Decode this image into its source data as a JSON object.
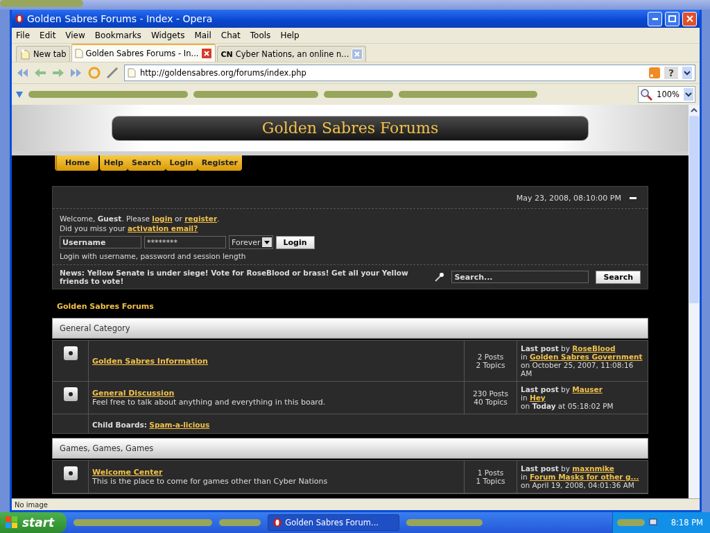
{
  "window": {
    "title": "Golden Sabres Forums - Index - Opera"
  },
  "menu": [
    "File",
    "Edit",
    "View",
    "Bookmarks",
    "Widgets",
    "Mail",
    "Chat",
    "Tools",
    "Help"
  ],
  "tabs": [
    {
      "kind": "new",
      "label": "New tab",
      "selected": false
    },
    {
      "kind": "page",
      "label": "Golden Sabres Forums - In...",
      "selected": true
    },
    {
      "kind": "logo",
      "badge": "CN",
      "label": "Cyber Nations, an online n...",
      "selected": false
    }
  ],
  "address": {
    "url": "http://goldensabres.org/forums/index.php",
    "help": "?"
  },
  "zoom": {
    "value": "100%"
  },
  "page": {
    "site_title": "Golden Sabres Forums",
    "nav": [
      {
        "label": "Home",
        "selected": true
      },
      {
        "label": "Help",
        "selected": false
      },
      {
        "label": "Search",
        "selected": false
      },
      {
        "label": "Login",
        "selected": false
      },
      {
        "label": "Register",
        "selected": false
      }
    ],
    "date": "May 23, 2008, 08:10:00 PM",
    "welcome": [
      {
        "kind": "text",
        "text": "Welcome, **Guest**. Please "
      },
      {
        "kind": "link",
        "text": "login"
      },
      {
        "kind": "text",
        "text": " or "
      },
      {
        "kind": "link",
        "text": "register"
      },
      {
        "kind": "text",
        "text": "."
      }
    ],
    "activation": [
      {
        "kind": "text",
        "text": "Did you miss your "
      },
      {
        "kind": "link",
        "text": "activation email?"
      }
    ],
    "login": {
      "username": "Username",
      "password": "********",
      "length": "Forever",
      "button": "Login",
      "hint": "Login with username, password and session length"
    },
    "news": "**News:**  Yellow Senate is under siege!  Vote for RoseBlood or brass! Get all your Yellow friends to vote!",
    "search": {
      "value": "Search...",
      "button": "Search"
    },
    "board_index": "Golden Sabres Forums",
    "categories": [
      {
        "name": "General Category",
        "boards": [
          {
            "title": "Golden Sabres Information",
            "posts": "2 Posts",
            "topics": "2 Topics",
            "last_label": "Last post",
            "by_label": "by",
            "in_label": "in",
            "by": "RoseBlood",
            "in": "Golden Sabres Government",
            "on": "on October 25, 2007, 11:08:16 AM"
          },
          {
            "title": "General Discussion",
            "description": "Feel free to talk about anything and everything in this board.",
            "posts": "230 Posts",
            "topics": "40 Topics",
            "last_label": "Last post",
            "by_label": "by",
            "in_label": "in",
            "by": "Mauser",
            "in": "Hey",
            "on": "on **Today** at 05:18:02 PM",
            "child_label": "Child Boards:",
            "child_boards": [
              "Spam-a-licious"
            ]
          }
        ]
      },
      {
        "name": "Games, Games, Games",
        "boards": [
          {
            "title": "Welcome Center",
            "description": "This is the place to come for games other than Cyber Nations",
            "posts": "1 Posts",
            "topics": "1 Topics",
            "last_label": "Last post",
            "by_label": "by",
            "in_label": "in",
            "by": "maxnmike",
            "in": "Forum Masks for other g...",
            "on": "on April 19, 2008, 04:01:36 AM"
          }
        ]
      }
    ]
  },
  "status_bar": {
    "text": "No image"
  },
  "taskbar": {
    "start": "start",
    "task": "Golden Sabres Forum...",
    "clock": "8:18 PM"
  }
}
